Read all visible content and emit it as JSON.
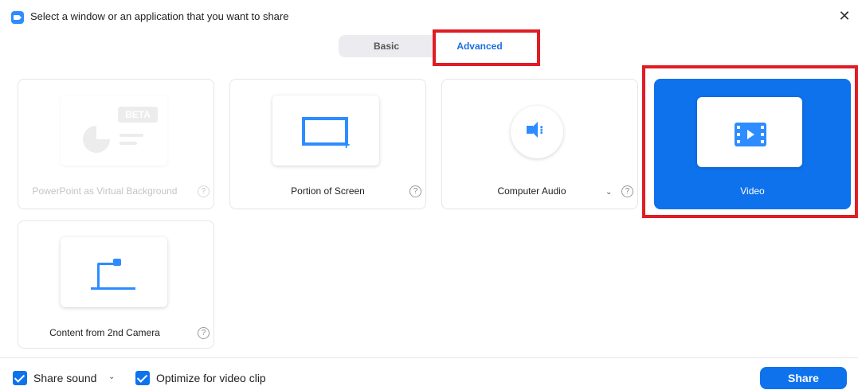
{
  "window": {
    "title": "Select a window or an application that you want to share",
    "close_icon": "close-icon"
  },
  "tabs": [
    {
      "label": "Basic",
      "selected": false
    },
    {
      "label": "Advanced",
      "selected": true
    }
  ],
  "options": {
    "powerpoint": {
      "label": "PowerPoint as Virtual Background",
      "badge": "BETA",
      "disabled": true,
      "icon": "presentation-icon"
    },
    "portion": {
      "label": "Portion of Screen",
      "icon": "screen-portion-icon"
    },
    "audio": {
      "label": "Computer Audio",
      "icon": "speaker-icon"
    },
    "video": {
      "label": "Video",
      "selected": true,
      "icon": "film-icon"
    },
    "camera": {
      "label": "Content from 2nd Camera",
      "icon": "document-camera-icon"
    }
  },
  "footer": {
    "share_sound_label": "Share sound",
    "share_sound_checked": true,
    "optimize_label": "Optimize for video clip",
    "optimize_checked": true,
    "share_button_label": "Share"
  },
  "colors": {
    "accent": "#0e72ed",
    "highlight_box": "#e01c24"
  }
}
